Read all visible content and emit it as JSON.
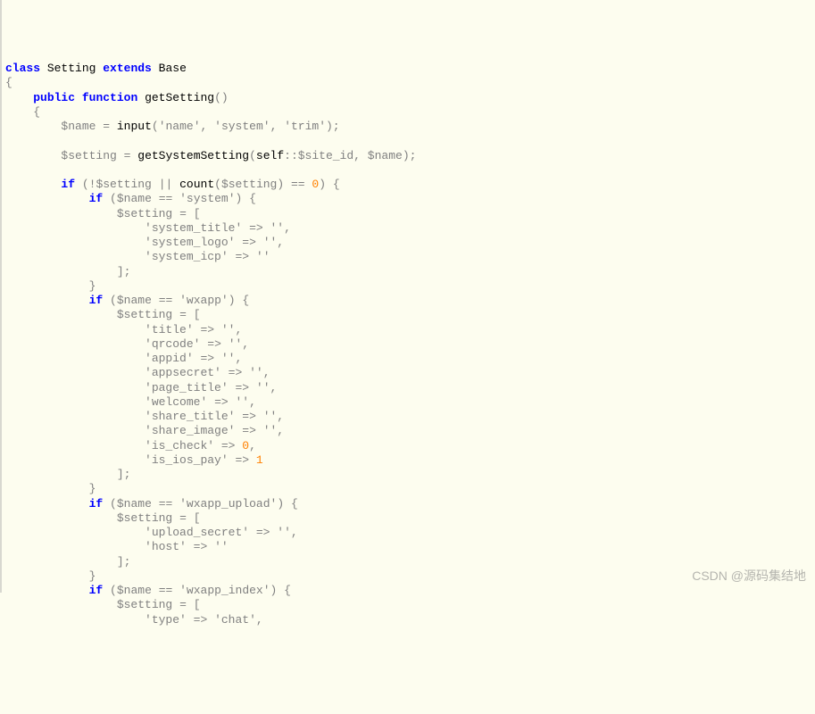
{
  "code": {
    "lines": [
      [
        [
          "kw",
          "class"
        ],
        [
          "sp",
          " "
        ],
        [
          "cls",
          "Setting"
        ],
        [
          "sp",
          " "
        ],
        [
          "kw",
          "extends"
        ],
        [
          "sp",
          " "
        ],
        [
          "cls",
          "Base"
        ]
      ],
      [
        [
          "sym",
          "{"
        ]
      ],
      [
        [
          "sp",
          "    "
        ],
        [
          "kw",
          "public"
        ],
        [
          "sp",
          " "
        ],
        [
          "kw",
          "function"
        ],
        [
          "sp",
          " "
        ],
        [
          "fn",
          "getSetting"
        ],
        [
          "sym",
          "()"
        ]
      ],
      [
        [
          "sp",
          "    "
        ],
        [
          "sym",
          "{"
        ]
      ],
      [
        [
          "sp",
          "        "
        ],
        [
          "var",
          "$name"
        ],
        [
          "sp",
          " "
        ],
        [
          "op",
          "="
        ],
        [
          "sp",
          " "
        ],
        [
          "fn",
          "input"
        ],
        [
          "sym",
          "("
        ],
        [
          "str",
          "'name'"
        ],
        [
          "sym",
          ","
        ],
        [
          "sp",
          " "
        ],
        [
          "str",
          "'system'"
        ],
        [
          "sym",
          ","
        ],
        [
          "sp",
          " "
        ],
        [
          "str",
          "'trim'"
        ],
        [
          "sym",
          ");"
        ]
      ],
      [
        [
          "sp",
          ""
        ]
      ],
      [
        [
          "sp",
          "        "
        ],
        [
          "var",
          "$setting"
        ],
        [
          "sp",
          " "
        ],
        [
          "op",
          "="
        ],
        [
          "sp",
          " "
        ],
        [
          "fn",
          "getSystemSetting"
        ],
        [
          "sym",
          "("
        ],
        [
          "scope",
          "self"
        ],
        [
          "sym",
          "::"
        ],
        [
          "var",
          "$site_id"
        ],
        [
          "sym",
          ","
        ],
        [
          "sp",
          " "
        ],
        [
          "var",
          "$name"
        ],
        [
          "sym",
          ");"
        ]
      ],
      [
        [
          "sp",
          ""
        ]
      ],
      [
        [
          "sp",
          "        "
        ],
        [
          "kw",
          "if"
        ],
        [
          "sp",
          " "
        ],
        [
          "sym",
          "(!"
        ],
        [
          "var",
          "$setting"
        ],
        [
          "sp",
          " "
        ],
        [
          "op",
          "||"
        ],
        [
          "sp",
          " "
        ],
        [
          "fn",
          "count"
        ],
        [
          "sym",
          "("
        ],
        [
          "var",
          "$setting"
        ],
        [
          "sym",
          ")"
        ],
        [
          "sp",
          " "
        ],
        [
          "op",
          "=="
        ],
        [
          "sp",
          " "
        ],
        [
          "num",
          "0"
        ],
        [
          "sym",
          ")"
        ],
        [
          "sp",
          " "
        ],
        [
          "sym",
          "{"
        ]
      ],
      [
        [
          "sp",
          "            "
        ],
        [
          "kw",
          "if"
        ],
        [
          "sp",
          " "
        ],
        [
          "sym",
          "("
        ],
        [
          "var",
          "$name"
        ],
        [
          "sp",
          " "
        ],
        [
          "op",
          "=="
        ],
        [
          "sp",
          " "
        ],
        [
          "str",
          "'system'"
        ],
        [
          "sym",
          ")"
        ],
        [
          "sp",
          " "
        ],
        [
          "sym",
          "{"
        ]
      ],
      [
        [
          "sp",
          "                "
        ],
        [
          "var",
          "$setting"
        ],
        [
          "sp",
          " "
        ],
        [
          "op",
          "="
        ],
        [
          "sp",
          " "
        ],
        [
          "sym",
          "["
        ]
      ],
      [
        [
          "sp",
          "                    "
        ],
        [
          "str",
          "'system_title'"
        ],
        [
          "sp",
          " "
        ],
        [
          "op",
          "=>"
        ],
        [
          "sp",
          " "
        ],
        [
          "str",
          "''"
        ],
        [
          "sym",
          ","
        ]
      ],
      [
        [
          "sp",
          "                    "
        ],
        [
          "str",
          "'system_logo'"
        ],
        [
          "sp",
          " "
        ],
        [
          "op",
          "=>"
        ],
        [
          "sp",
          " "
        ],
        [
          "str",
          "''"
        ],
        [
          "sym",
          ","
        ]
      ],
      [
        [
          "sp",
          "                    "
        ],
        [
          "str",
          "'system_icp'"
        ],
        [
          "sp",
          " "
        ],
        [
          "op",
          "=>"
        ],
        [
          "sp",
          " "
        ],
        [
          "str",
          "''"
        ]
      ],
      [
        [
          "sp",
          "                "
        ],
        [
          "sym",
          "];"
        ]
      ],
      [
        [
          "sp",
          "            "
        ],
        [
          "sym",
          "}"
        ]
      ],
      [
        [
          "sp",
          "            "
        ],
        [
          "kw",
          "if"
        ],
        [
          "sp",
          " "
        ],
        [
          "sym",
          "("
        ],
        [
          "var",
          "$name"
        ],
        [
          "sp",
          " "
        ],
        [
          "op",
          "=="
        ],
        [
          "sp",
          " "
        ],
        [
          "str",
          "'wxapp'"
        ],
        [
          "sym",
          ")"
        ],
        [
          "sp",
          " "
        ],
        [
          "sym",
          "{"
        ]
      ],
      [
        [
          "sp",
          "                "
        ],
        [
          "var",
          "$setting"
        ],
        [
          "sp",
          " "
        ],
        [
          "op",
          "="
        ],
        [
          "sp",
          " "
        ],
        [
          "sym",
          "["
        ]
      ],
      [
        [
          "sp",
          "                    "
        ],
        [
          "str",
          "'title'"
        ],
        [
          "sp",
          " "
        ],
        [
          "op",
          "=>"
        ],
        [
          "sp",
          " "
        ],
        [
          "str",
          "''"
        ],
        [
          "sym",
          ","
        ]
      ],
      [
        [
          "sp",
          "                    "
        ],
        [
          "str",
          "'qrcode'"
        ],
        [
          "sp",
          " "
        ],
        [
          "op",
          "=>"
        ],
        [
          "sp",
          " "
        ],
        [
          "str",
          "''"
        ],
        [
          "sym",
          ","
        ]
      ],
      [
        [
          "sp",
          "                    "
        ],
        [
          "str",
          "'appid'"
        ],
        [
          "sp",
          " "
        ],
        [
          "op",
          "=>"
        ],
        [
          "sp",
          " "
        ],
        [
          "str",
          "''"
        ],
        [
          "sym",
          ","
        ]
      ],
      [
        [
          "sp",
          "                    "
        ],
        [
          "str",
          "'appsecret'"
        ],
        [
          "sp",
          " "
        ],
        [
          "op",
          "=>"
        ],
        [
          "sp",
          " "
        ],
        [
          "str",
          "''"
        ],
        [
          "sym",
          ","
        ]
      ],
      [
        [
          "sp",
          "                    "
        ],
        [
          "str",
          "'page_title'"
        ],
        [
          "sp",
          " "
        ],
        [
          "op",
          "=>"
        ],
        [
          "sp",
          " "
        ],
        [
          "str",
          "''"
        ],
        [
          "sym",
          ","
        ]
      ],
      [
        [
          "sp",
          "                    "
        ],
        [
          "str",
          "'welcome'"
        ],
        [
          "sp",
          " "
        ],
        [
          "op",
          "=>"
        ],
        [
          "sp",
          " "
        ],
        [
          "str",
          "''"
        ],
        [
          "sym",
          ","
        ]
      ],
      [
        [
          "sp",
          "                    "
        ],
        [
          "str",
          "'share_title'"
        ],
        [
          "sp",
          " "
        ],
        [
          "op",
          "=>"
        ],
        [
          "sp",
          " "
        ],
        [
          "str",
          "''"
        ],
        [
          "sym",
          ","
        ]
      ],
      [
        [
          "sp",
          "                    "
        ],
        [
          "str",
          "'share_image'"
        ],
        [
          "sp",
          " "
        ],
        [
          "op",
          "=>"
        ],
        [
          "sp",
          " "
        ],
        [
          "str",
          "''"
        ],
        [
          "sym",
          ","
        ]
      ],
      [
        [
          "sp",
          "                    "
        ],
        [
          "str",
          "'is_check'"
        ],
        [
          "sp",
          " "
        ],
        [
          "op",
          "=>"
        ],
        [
          "sp",
          " "
        ],
        [
          "num",
          "0"
        ],
        [
          "sym",
          ","
        ]
      ],
      [
        [
          "sp",
          "                    "
        ],
        [
          "str",
          "'is_ios_pay'"
        ],
        [
          "sp",
          " "
        ],
        [
          "op",
          "=>"
        ],
        [
          "sp",
          " "
        ],
        [
          "num",
          "1"
        ]
      ],
      [
        [
          "sp",
          "                "
        ],
        [
          "sym",
          "];"
        ]
      ],
      [
        [
          "sp",
          "            "
        ],
        [
          "sym",
          "}"
        ]
      ],
      [
        [
          "sp",
          "            "
        ],
        [
          "kw",
          "if"
        ],
        [
          "sp",
          " "
        ],
        [
          "sym",
          "("
        ],
        [
          "var",
          "$name"
        ],
        [
          "sp",
          " "
        ],
        [
          "op",
          "=="
        ],
        [
          "sp",
          " "
        ],
        [
          "str",
          "'wxapp_upload'"
        ],
        [
          "sym",
          ")"
        ],
        [
          "sp",
          " "
        ],
        [
          "sym",
          "{"
        ]
      ],
      [
        [
          "sp",
          "                "
        ],
        [
          "var",
          "$setting"
        ],
        [
          "sp",
          " "
        ],
        [
          "op",
          "="
        ],
        [
          "sp",
          " "
        ],
        [
          "sym",
          "["
        ]
      ],
      [
        [
          "sp",
          "                    "
        ],
        [
          "str",
          "'upload_secret'"
        ],
        [
          "sp",
          " "
        ],
        [
          "op",
          "=>"
        ],
        [
          "sp",
          " "
        ],
        [
          "str",
          "''"
        ],
        [
          "sym",
          ","
        ]
      ],
      [
        [
          "sp",
          "                    "
        ],
        [
          "str",
          "'host'"
        ],
        [
          "sp",
          " "
        ],
        [
          "op",
          "=>"
        ],
        [
          "sp",
          " "
        ],
        [
          "str",
          "''"
        ]
      ],
      [
        [
          "sp",
          "                "
        ],
        [
          "sym",
          "];"
        ]
      ],
      [
        [
          "sp",
          "            "
        ],
        [
          "sym",
          "}"
        ]
      ],
      [
        [
          "sp",
          "            "
        ],
        [
          "kw",
          "if"
        ],
        [
          "sp",
          " "
        ],
        [
          "sym",
          "("
        ],
        [
          "var",
          "$name"
        ],
        [
          "sp",
          " "
        ],
        [
          "op",
          "=="
        ],
        [
          "sp",
          " "
        ],
        [
          "str",
          "'wxapp_index'"
        ],
        [
          "sym",
          ")"
        ],
        [
          "sp",
          " "
        ],
        [
          "sym",
          "{"
        ]
      ],
      [
        [
          "sp",
          "                "
        ],
        [
          "var",
          "$setting"
        ],
        [
          "sp",
          " "
        ],
        [
          "op",
          "="
        ],
        [
          "sp",
          " "
        ],
        [
          "sym",
          "["
        ]
      ],
      [
        [
          "sp",
          "                    "
        ],
        [
          "str",
          "'type'"
        ],
        [
          "sp",
          " "
        ],
        [
          "op",
          "=>"
        ],
        [
          "sp",
          " "
        ],
        [
          "str",
          "'chat'"
        ],
        [
          "sym",
          ","
        ]
      ]
    ]
  },
  "watermark": "CSDN @源码集结地"
}
